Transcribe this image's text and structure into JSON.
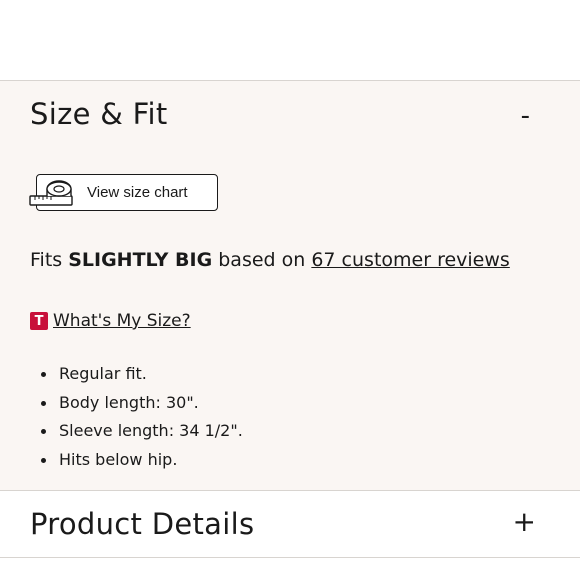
{
  "size_fit": {
    "title": "Size & Fit",
    "toggle": "-",
    "size_chart_label": "View size chart",
    "fit_prefix": "Fits ",
    "fit_value": "SLIGHTLY BIG",
    "fit_middle": " based on ",
    "reviews_link": "67 customer reviews",
    "badge_letter": "T",
    "whats_my_size": "What's My Size?",
    "details": [
      "Regular fit.",
      "Body length: 30\".",
      "Sleeve length: 34 1/2\".",
      "Hits below hip."
    ]
  },
  "product_details": {
    "title": "Product Details",
    "toggle": "+"
  },
  "colors": {
    "section_bg": "#faf6f3",
    "badge": "#c8103a",
    "text": "#1a1a1a",
    "divider": "#d8d4d0"
  },
  "icons": {
    "tape": "measuring-tape-icon"
  }
}
